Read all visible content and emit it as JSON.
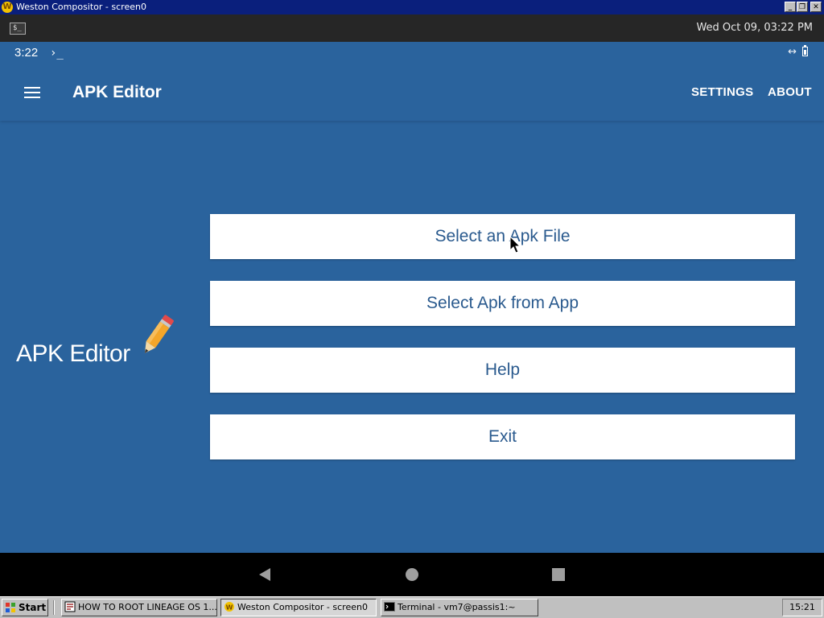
{
  "window": {
    "title": "Weston Compositor - screen0",
    "icon_letter": "W",
    "controls": {
      "minimize": "_",
      "restore": "❐",
      "close": "✕"
    }
  },
  "weston_panel": {
    "terminal_icon_glyph": "$_",
    "clock": "Wed Oct 09, 03:22 PM"
  },
  "status_bar": {
    "time": "3:22",
    "prompt_icon": "›_",
    "network_icon": "↔"
  },
  "app_bar": {
    "title": "APK Editor",
    "actions": {
      "settings": "SETTINGS",
      "about": "ABOUT"
    }
  },
  "logo": {
    "text": "APK Editor"
  },
  "main_menu": {
    "select_apk_file": "Select an Apk File",
    "select_apk_from_app": "Select Apk from App",
    "help": "Help",
    "exit": "Exit"
  },
  "taskbar": {
    "start_label": "Start",
    "tasks": [
      {
        "label": "HOW TO ROOT LINEAGE OS 1...",
        "active": false
      },
      {
        "label": "Weston Compositor - screen0",
        "active": true
      },
      {
        "label": "Terminal - vm7@passis1:~",
        "active": false
      }
    ],
    "clock": "15:21"
  },
  "colors": {
    "app_primary": "#2a639d",
    "button_text": "#2a5a8e",
    "title_bar": "#0a1f7c",
    "taskbar": "#c0c0c0"
  }
}
